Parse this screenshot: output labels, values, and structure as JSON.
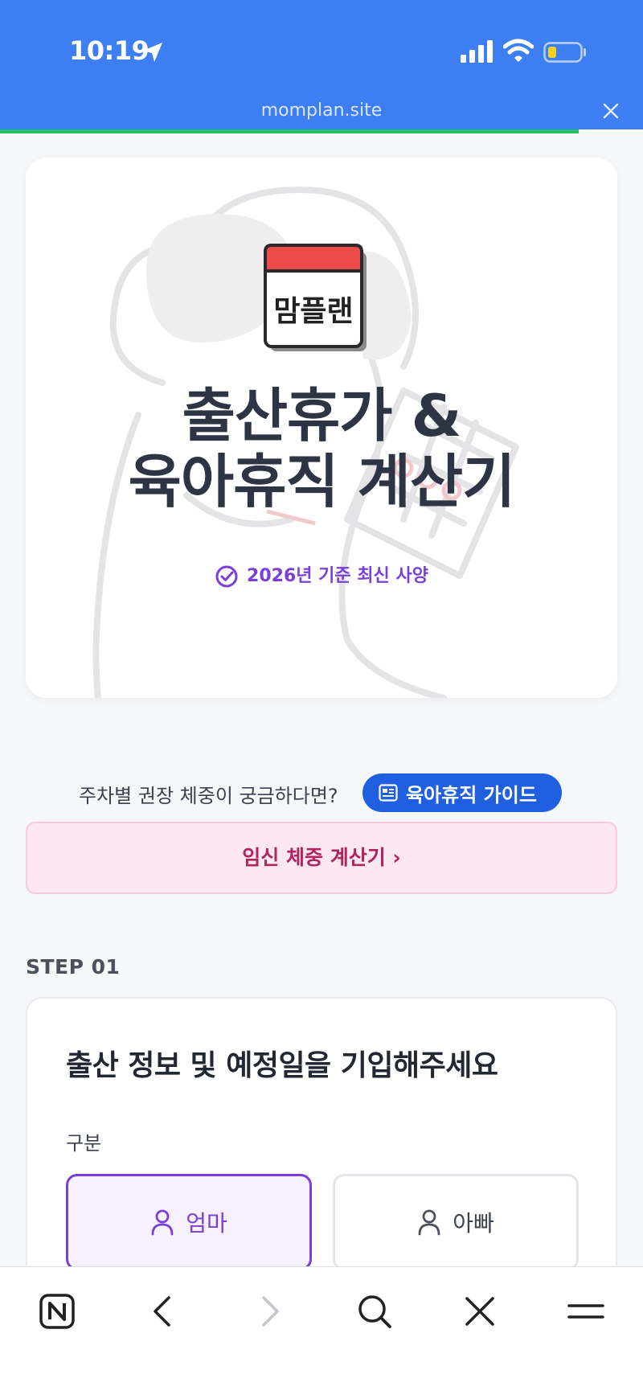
{
  "status_bar": {
    "time": "10:19"
  },
  "browser": {
    "url": "momplan.site",
    "load_progress": 0.9
  },
  "hero": {
    "logo_text": "맘플랜",
    "title_line1": "출산휴가 &",
    "title_line2": "육아휴직 계산기",
    "badge": "2026년 기준 최신 사양"
  },
  "guide": {
    "prompt": "주차별 권장 체중이 궁금하다면?",
    "button_label": "육아휴직 가이드"
  },
  "weight_calc": {
    "label": "임신 체중 계산기 ›"
  },
  "step": {
    "label": "STEP 01",
    "title": "출산 정보 및 예정일을 기입해주세요",
    "field_label": "구분",
    "options": [
      "엄마",
      "아빠"
    ],
    "selected": "엄마"
  },
  "colors": {
    "chrome_blue": "#3d7ef2",
    "accent_purple": "#7b3fd9",
    "guide_blue": "#1f5fe0",
    "pink_bg": "#fde8f1",
    "pink_text": "#b0245f",
    "progress_green": "#21c16b"
  },
  "icons": [
    "location-arrow-icon",
    "signal-icon",
    "wifi-icon",
    "battery-icon",
    "close-icon",
    "check-circle-icon",
    "document-icon",
    "person-icon",
    "naver-home-icon",
    "back-icon",
    "forward-icon",
    "search-icon",
    "tab-close-icon",
    "menu-icon"
  ]
}
